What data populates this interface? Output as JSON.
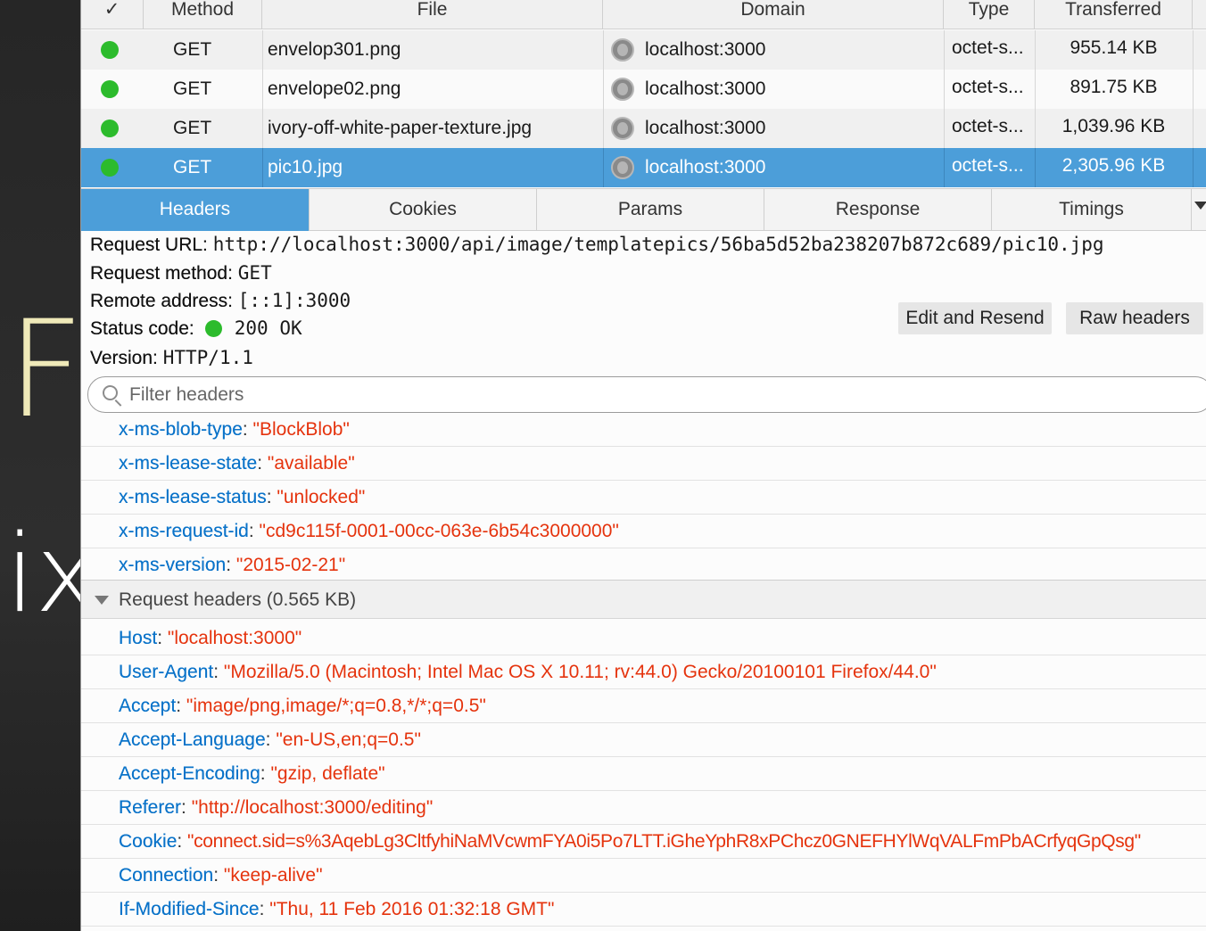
{
  "background_page": {
    "letter_f": "F",
    "text_ix": "ix"
  },
  "table": {
    "columns": [
      "✓",
      "Method",
      "File",
      "Domain",
      "Type",
      "Transferred"
    ],
    "rows": [
      {
        "method": "GET",
        "file": "envelop301.png",
        "domain": "localhost:3000",
        "type": "octet-s...",
        "transferred": "955.14 KB"
      },
      {
        "method": "GET",
        "file": "envelope02.png",
        "domain": "localhost:3000",
        "type": "octet-s...",
        "transferred": "891.75 KB"
      },
      {
        "method": "GET",
        "file": "ivory-off-white-paper-texture.jpg",
        "domain": "localhost:3000",
        "type": "octet-s...",
        "transferred": "1,039.96 KB"
      },
      {
        "method": "GET",
        "file": "pic10.jpg",
        "domain": "localhost:3000",
        "type": "octet-s...",
        "transferred": "2,305.96 KB"
      }
    ]
  },
  "tabs": [
    "Headers",
    "Cookies",
    "Params",
    "Response",
    "Timings"
  ],
  "summary": {
    "url_label": "Request URL:",
    "url": "http://localhost:3000/api/image/templatepics/56ba5d52ba238207b872c689/pic10.jpg",
    "method_label": "Request method:",
    "method": "GET",
    "remote_label": "Remote address:",
    "remote": "[::1]:3000",
    "status_label": "Status code:",
    "status": "200 OK",
    "version_label": "Version:",
    "version": "HTTP/1.1"
  },
  "buttons": {
    "edit_resend": "Edit and Resend",
    "raw_headers": "Raw headers"
  },
  "filter": {
    "placeholder": "Filter headers"
  },
  "response_headers": [
    {
      "name": "x-ms-blob-type",
      "value": "\"BlockBlob\""
    },
    {
      "name": "x-ms-lease-state",
      "value": "\"available\""
    },
    {
      "name": "x-ms-lease-status",
      "value": "\"unlocked\""
    },
    {
      "name": "x-ms-request-id",
      "value": "\"cd9c115f-0001-00cc-063e-6b54c3000000\""
    },
    {
      "name": "x-ms-version",
      "value": "\"2015-02-21\""
    }
  ],
  "request_section": {
    "title": "Request headers (0.565 KB)"
  },
  "request_headers": [
    {
      "name": "Host",
      "value": "\"localhost:3000\""
    },
    {
      "name": "User-Agent",
      "value": "\"Mozilla/5.0 (Macintosh; Intel Mac OS X 10.11; rv:44.0) Gecko/20100101 Firefox/44.0\""
    },
    {
      "name": "Accept",
      "value": "\"image/png,image/*;q=0.8,*/*;q=0.5\""
    },
    {
      "name": "Accept-Language",
      "value": "\"en-US,en;q=0.5\""
    },
    {
      "name": "Accept-Encoding",
      "value": "\"gzip, deflate\""
    },
    {
      "name": "Referer",
      "value": "\"http://localhost:3000/editing\""
    },
    {
      "name": "Cookie",
      "value": "\"connect.sid=s%3AqebLg3CltfyhiNaMVcwmFYA0i5Po7LTT.iGheYphR8xPChcz0GNEFHYlWqVALFmPbACrfyqGpQsg\""
    },
    {
      "name": "Connection",
      "value": "\"keep-alive\""
    },
    {
      "name": "If-Modified-Since",
      "value": "\"Thu, 11 Feb 2016 01:32:18 GMT\""
    }
  ],
  "colors": {
    "accent": "#4c9ed9",
    "status_ok": "#2cbb2c",
    "header_name": "#0a73c9",
    "header_value": "#e5330d"
  }
}
